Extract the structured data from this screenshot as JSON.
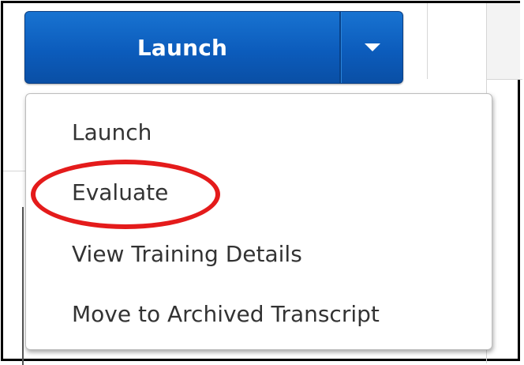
{
  "launch_button": {
    "label": "Launch",
    "color": "#0c5cbc"
  },
  "dropdown_toggle": {
    "icon": "caret-down-icon"
  },
  "menu": {
    "items": [
      {
        "label": "Launch"
      },
      {
        "label": "Evaluate",
        "highlighted": true
      },
      {
        "label": "View Training Details"
      },
      {
        "label": "Move to Archived Transcript"
      }
    ]
  },
  "annotation": {
    "type": "ellipse",
    "color": "#e41b1b",
    "target": "Evaluate"
  }
}
